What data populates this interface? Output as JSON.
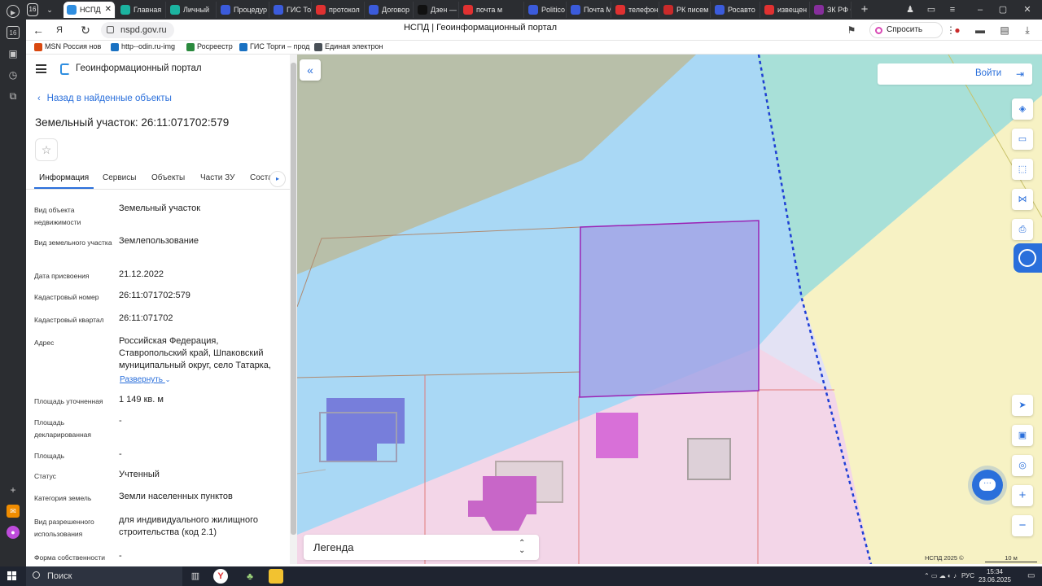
{
  "browser": {
    "tab_count": "16",
    "tabs": [
      {
        "label": "НСПД",
        "color": "#2f8ee0"
      },
      {
        "label": "Главная",
        "color": "#1bb3a0"
      },
      {
        "label": "Личный",
        "color": "#1bb3a0"
      },
      {
        "label": "Процедур",
        "color": "#3b5bdb"
      },
      {
        "label": "ГИС Торги",
        "color": "#3b5bdb"
      },
      {
        "label": "протокол",
        "color": "#e03131"
      },
      {
        "label": "Договор",
        "color": "#3b5bdb"
      },
      {
        "label": "Дзен —",
        "color": "#111111"
      },
      {
        "label": "почта м",
        "color": "#e03131"
      },
      {
        "label": "Politico",
        "color": "#3b5bdb"
      },
      {
        "label": "Почта М",
        "color": "#3b5bdb"
      },
      {
        "label": "телефон",
        "color": "#e03131"
      },
      {
        "label": "РК писем",
        "color": "#c92a2a"
      },
      {
        "label": "Росавто",
        "color": "#3b5bdb"
      },
      {
        "label": "извещен",
        "color": "#e03131"
      },
      {
        "label": "ЗК РФ С",
        "color": "#862e9c"
      }
    ],
    "url": "nspd.gov.ru",
    "page_title": "НСПД | Геоинформационный портал",
    "ask_label": "Спросить",
    "bookmarks": [
      {
        "label": "MSN Россия нов",
        "color": "#d9480f"
      },
      {
        "label": "http--odin.ru-img",
        "color": "#1971c2"
      },
      {
        "label": "Росреестр",
        "color": "#2b8a3e"
      },
      {
        "label": "ГИС Торги – прод",
        "color": "#1971c2"
      },
      {
        "label": "Единая электрон",
        "color": "#495057"
      }
    ]
  },
  "panel": {
    "app_title": "Геоинформационный портал",
    "back_label": "Назад в найденные объекты",
    "object_title": "Земельный участок: 26:11:071702:579",
    "tabs": [
      "Информация",
      "Сервисы",
      "Объекты",
      "Части ЗУ",
      "Соста"
    ],
    "fields": [
      {
        "label": "Вид объекта недвижимости",
        "value": "Земельный участок"
      },
      {
        "label": "Вид земельного участка",
        "value": "Землепользование"
      },
      {
        "label": "Дата присвоения",
        "value": "21.12.2022"
      },
      {
        "label": "Кадастровый номер",
        "value": "26:11:071702:579"
      },
      {
        "label": "Кадастровый квартал",
        "value": "26:11:071702"
      },
      {
        "label": "Адрес",
        "value": "Российская Федерация, Ставропольский край, Шпаковский муниципальный округ, село Татарка,"
      },
      {
        "label": "Площадь уточненная",
        "value": "1 149 кв. м"
      },
      {
        "label": "Площадь декларированная",
        "value": "-"
      },
      {
        "label": "Площадь",
        "value": "-"
      },
      {
        "label": "Статус",
        "value": "Учтенный"
      },
      {
        "label": "Категория земель",
        "value": "Земли населенных пунктов"
      },
      {
        "label": "Вид разрешенного использования",
        "value": "для индивидуального жилищного строительства (код 2.1)"
      },
      {
        "label": "Форма собственности",
        "value": "-"
      }
    ],
    "expand_label": "Развернуть"
  },
  "map": {
    "login_label": "Войти",
    "legend_label": "Легенда",
    "copyright": "НСПД 2025 ©",
    "scale_label": "10 м"
  },
  "taskbar": {
    "search_label": "Поиск",
    "lang": "РУС",
    "time": "15:34",
    "date": "23.06.2025"
  }
}
